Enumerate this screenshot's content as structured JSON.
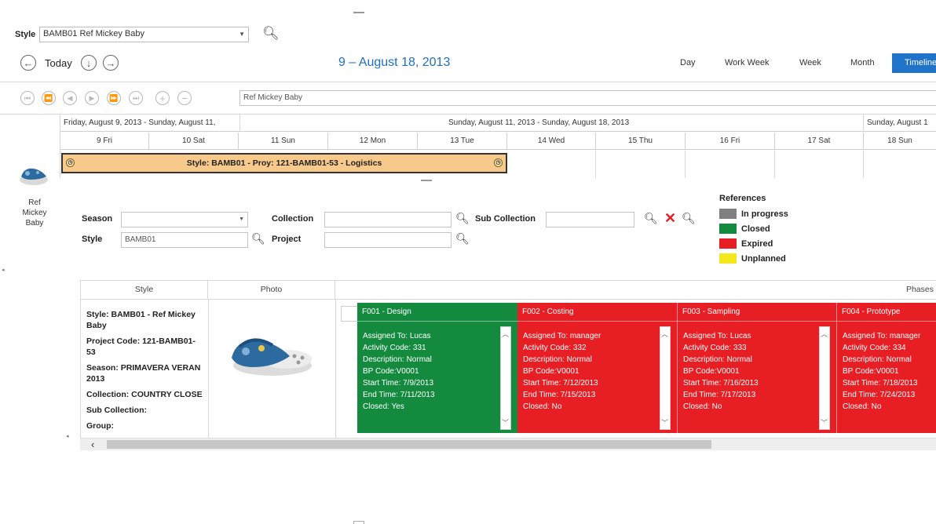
{
  "toolbar": {
    "style_label": "Style",
    "style_value": "BAMB01 Ref Mickey Baby",
    "today_label": "Today",
    "date_title": "9 – August 18, 2013",
    "views": [
      "Day",
      "Work Week",
      "Week",
      "Month",
      "Timeline"
    ],
    "active_view": "Timeline",
    "search_text": "Ref Mickey Baby"
  },
  "timeline": {
    "ranges": [
      "Friday, August 9, 2013 - Sunday, August 11,",
      "Sunday, August 11, 2013 - Sunday, August 18, 2013",
      "Sunday, August 1"
    ],
    "days": [
      "9 Fri",
      "10 Sat",
      "11 Sun",
      "12 Mon",
      "13 Tue",
      "14 Wed",
      "15 Thu",
      "16 Fri",
      "17 Sat",
      "18 Sun"
    ],
    "event_label": "Style: BAMB01 - Proy: 121-BAMB01-53 - Logistics",
    "resource_label": "Ref Mickey Baby"
  },
  "filters": {
    "season_label": "Season",
    "season_value": "",
    "collection_label": "Collection",
    "sub_collection_label": "Sub Collection",
    "style_label": "Style",
    "style_value": "BAMB01",
    "project_label": "Project"
  },
  "references": {
    "title": "References",
    "items": [
      {
        "label": "In progress",
        "color": "#808080"
      },
      {
        "label": "Closed",
        "color": "#148a3f"
      },
      {
        "label": "Expired",
        "color": "#e81e25"
      },
      {
        "label": "Unplanned",
        "color": "#f4e71c"
      }
    ]
  },
  "grid": {
    "headers": {
      "style": "Style",
      "photo": "Photo",
      "phases": "Phases"
    },
    "info": [
      "Style: BAMB01 - Ref Mickey",
      "Baby",
      "Project Code: 121-BAMB01-",
      "53",
      "Season: PRIMAVERA VERAN",
      "2013",
      "Collection: COUNTRY CLOSE",
      "Sub Collection:",
      "Group:"
    ],
    "phases": [
      {
        "title": "F001 - Design",
        "lines": [
          "Assigned To: Lucas",
          "Activity Code: 331",
          "Description: Normal",
          "BP Code:V0001",
          "Start Time: 7/9/2013",
          "End Time: 7/11/2013",
          "Closed: Yes"
        ]
      },
      {
        "title": "F002 - Costing",
        "lines": [
          "Assigned To: manager",
          "Activity Code: 332",
          "Description: Normal",
          "BP Code:V0001",
          "Start Time: 7/12/2013",
          "End Time: 7/15/2013",
          "Closed: No"
        ]
      },
      {
        "title": "F003 - Sampling",
        "lines": [
          "Assigned To: Lucas",
          "Activity Code: 333",
          "Description: Normal",
          "BP Code:V0001",
          "Start Time: 7/16/2013",
          "End Time: 7/17/2013",
          "Closed: No"
        ]
      },
      {
        "title": "F004 - Prototype",
        "lines": [
          "Assigned To: manager",
          "Activity Code: 334",
          "Description: Normal",
          "BP Code:V0001",
          "Start Time: 7/18/2013",
          "End Time: 7/24/2013",
          "Closed: No"
        ]
      }
    ]
  }
}
